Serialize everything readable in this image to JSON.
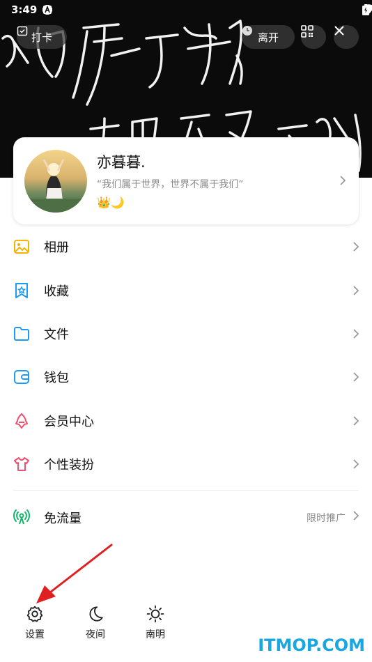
{
  "status_bar": {
    "time": "3:49"
  },
  "hero": {
    "background_color": "#0b0b0b",
    "checkin_label": "打卡",
    "leave_label": "离开"
  },
  "profile": {
    "nickname": "亦暮暮.",
    "signature": "“我们属于世界，世界不属于我们”",
    "badges": "👑🌙"
  },
  "menu": {
    "items": [
      {
        "label": "相册",
        "icon": "album-icon",
        "color": "#f5b400"
      },
      {
        "label": "收藏",
        "icon": "favorites-icon",
        "color": "#1e9bf0"
      },
      {
        "label": "文件",
        "icon": "folder-icon",
        "color": "#1e9bf0"
      },
      {
        "label": "钱包",
        "icon": "wallet-icon",
        "color": "#1e9bf0"
      },
      {
        "label": "会员中心",
        "icon": "vip-icon",
        "color": "#f0506e"
      },
      {
        "label": "个性装扮",
        "icon": "tshirt-icon",
        "color": "#f0506e"
      }
    ],
    "free_data": {
      "label": "免流量",
      "promo": "限时推广",
      "icon": "signal-icon",
      "color": "#12b76a"
    }
  },
  "bottom_bar": {
    "settings": "设置",
    "night": "夜间",
    "weather": "南明"
  },
  "watermark": "ITMOP.COM",
  "annotation_color": "#e02020"
}
